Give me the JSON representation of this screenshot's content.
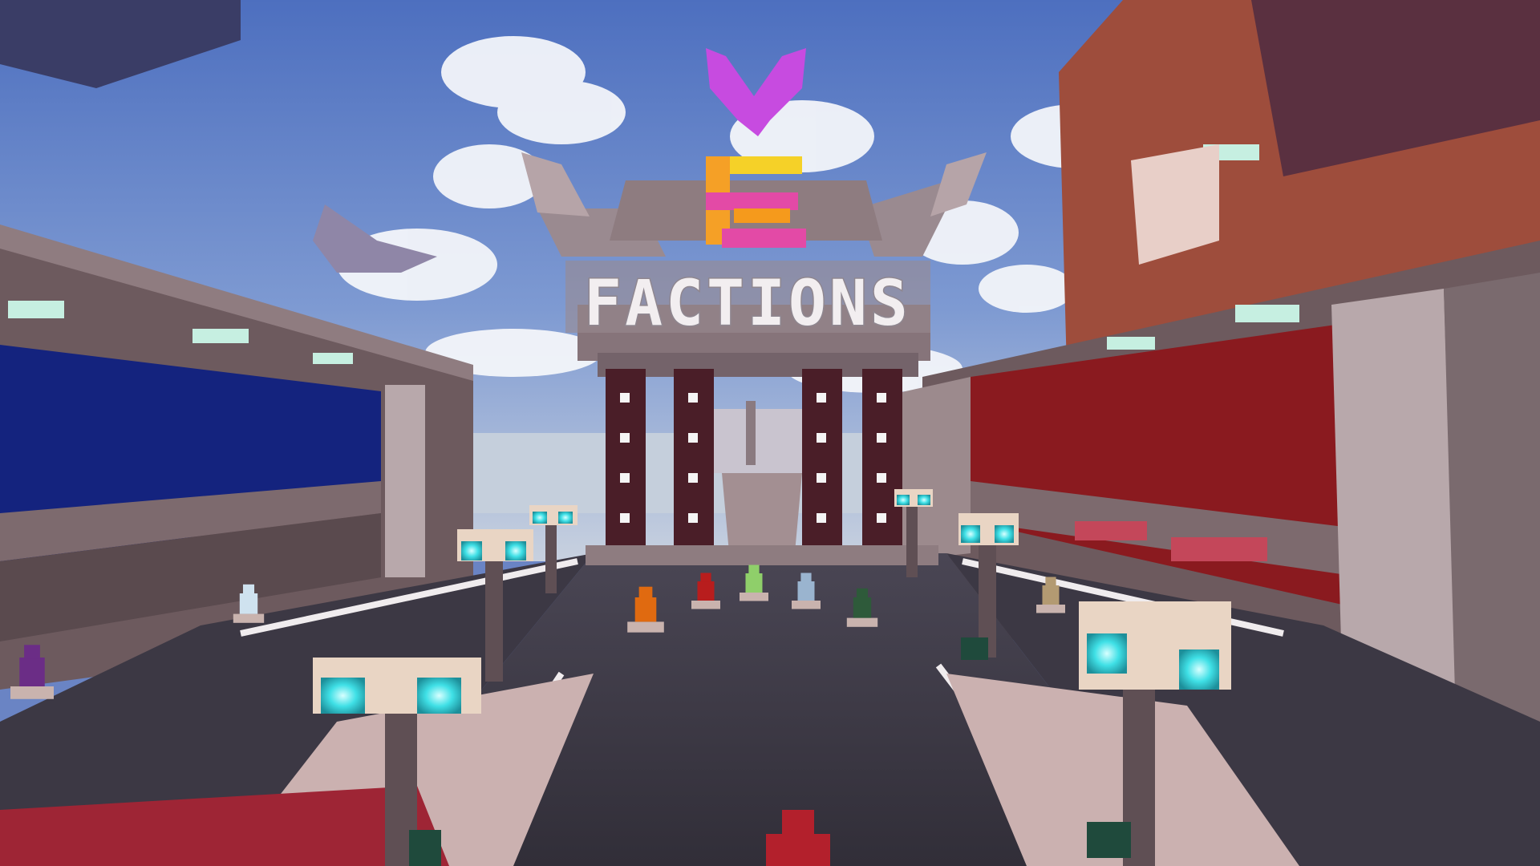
{
  "scene": {
    "sign": {
      "text": "FACTIONS"
    },
    "logo": {
      "letter": "E"
    },
    "statues": [
      {
        "name": "fire-dragon-statue",
        "color": "#e06a10"
      },
      {
        "name": "red-demon-statue",
        "color": "#b81d1d"
      },
      {
        "name": "green-knight-statue",
        "color": "#8fcf6a"
      },
      {
        "name": "blue-robot-statue",
        "color": "#9ab4cf"
      },
      {
        "name": "dark-warrior-statue",
        "color": "#2e5a3a"
      },
      {
        "name": "ice-golem-statue",
        "color": "#cfe2ef"
      },
      {
        "name": "purple-bat-statue",
        "color": "#6b2d86"
      },
      {
        "name": "golem-statue-right",
        "color": "#b39a72"
      }
    ],
    "colors": {
      "sky": "#5f80c8",
      "left_wall": "#14237e",
      "right_wall": "#8a1a1f",
      "road": "#3d3a46",
      "stone": "#8b7476",
      "lamp_glow": "#3fe0e6"
    }
  }
}
